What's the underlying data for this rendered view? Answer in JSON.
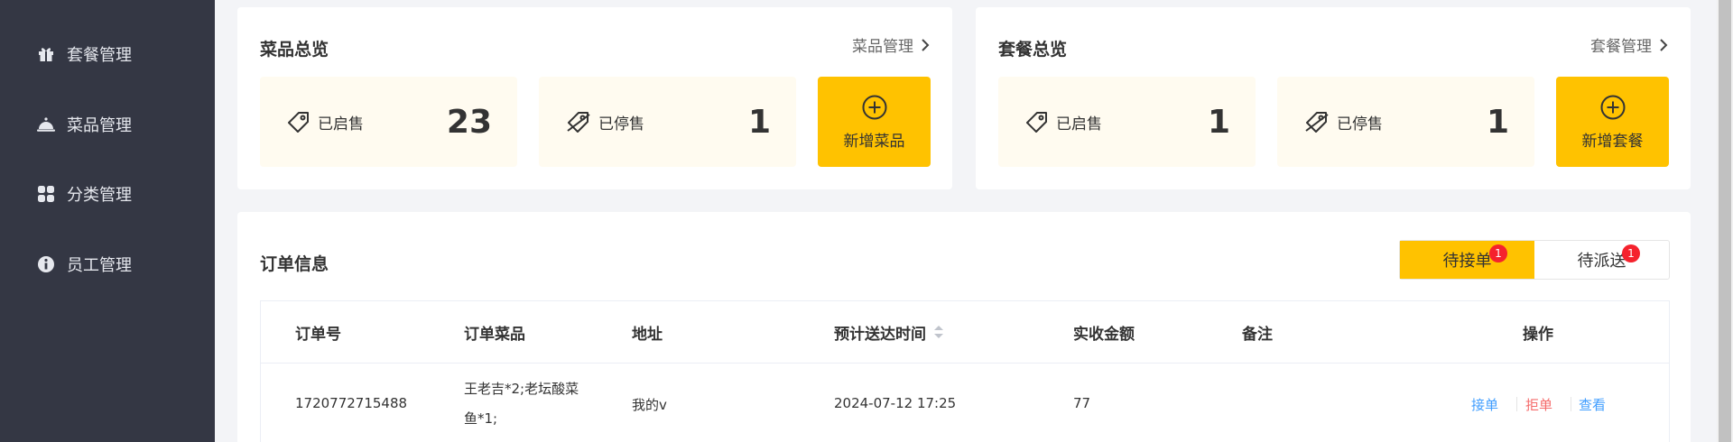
{
  "sidebar": {
    "items": [
      {
        "label": "套餐管理",
        "icon": "gift-icon"
      },
      {
        "label": "菜品管理",
        "icon": "dish-cover-icon"
      },
      {
        "label": "分类管理",
        "icon": "grid-icon"
      },
      {
        "label": "员工管理",
        "icon": "employee-icon"
      }
    ]
  },
  "dish_overview": {
    "title": "菜品总览",
    "link": "菜品管理",
    "on_sale_label": "已启售",
    "on_sale_count": "23",
    "off_sale_label": "已停售",
    "off_sale_count": "1",
    "add_label": "新增菜品"
  },
  "setmeal_overview": {
    "title": "套餐总览",
    "link": "套餐管理",
    "on_sale_label": "已启售",
    "on_sale_count": "1",
    "off_sale_label": "已停售",
    "off_sale_count": "1",
    "add_label": "新增套餐"
  },
  "orders": {
    "title": "订单信息",
    "tabs": [
      {
        "label": "待接单",
        "badge": "1",
        "active": true
      },
      {
        "label": "待派送",
        "badge": "1",
        "active": false
      }
    ],
    "columns": [
      "订单号",
      "订单菜品",
      "地址",
      "预计送达时间",
      "实收金额",
      "备注",
      "操作"
    ],
    "rows": [
      {
        "order_no": "1720772715488",
        "dishes_line1": "王老吉*2;老坛酸菜",
        "dishes_line2": "鱼*1;",
        "address": "我的v",
        "eta": "2024-07-12 17:25",
        "amount": "77",
        "remark": "",
        "actions": [
          "接单",
          "拒单",
          "查看"
        ]
      }
    ]
  },
  "colors": {
    "sidebar_bg": "#343744",
    "accent": "#ffc200",
    "stat_bg": "#fffbf0",
    "badge": "#f5222d",
    "link_blue": "#419eff",
    "reject_red": "#f56c6c"
  }
}
